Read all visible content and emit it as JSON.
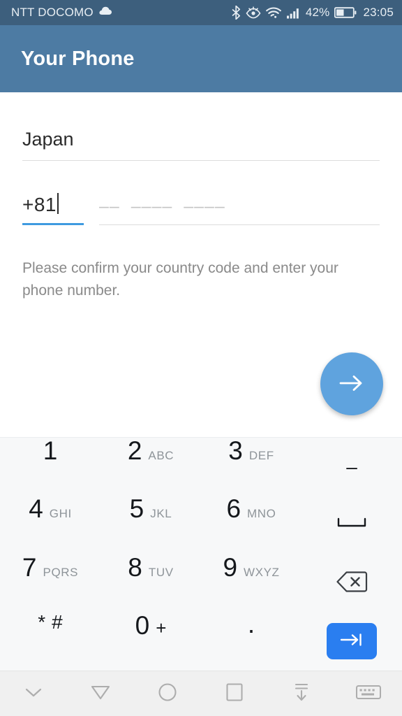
{
  "status_bar": {
    "carrier": "NTT DOCOMO",
    "cloud_icon": "cloud-icon",
    "bluetooth_icon": "bluetooth-icon",
    "eye_comfort_icon": "eye-comfort-icon",
    "wifi_icon": "wifi-icon",
    "signal_icon": "cellular-signal-icon",
    "battery_percent": "42%",
    "battery_icon": "battery-icon",
    "clock": "23:05",
    "background_color": "#3d5f7d",
    "text_color": "#e8eef3"
  },
  "app_bar": {
    "title": "Your Phone",
    "background_color": "#4d7ba3",
    "title_color": "#ffffff"
  },
  "form": {
    "country": {
      "value": "Japan",
      "underline_color": "#dcdcdc"
    },
    "country_code": {
      "value": "+81",
      "underline_color": "#3f9ae0",
      "focused": "true"
    },
    "phone_number": {
      "value": "",
      "placeholder": "––  ––––  ––––",
      "underline_color": "#dcdcdc"
    },
    "hint": "Please confirm your country code and enter your phone number."
  },
  "next_button": {
    "icon": "arrow-right-icon",
    "color": "#5fa3de"
  },
  "keypad": {
    "background_color": "#f7f8f9",
    "rows": [
      [
        {
          "digit": "1",
          "letters": "",
          "name": "key-1"
        },
        {
          "digit": "2",
          "letters": "ABC",
          "name": "key-2"
        },
        {
          "digit": "3",
          "letters": "DEF",
          "name": "key-3"
        },
        {
          "digit": "",
          "letters": "",
          "symbol": "–",
          "name": "key-dash"
        }
      ],
      [
        {
          "digit": "4",
          "letters": "GHI",
          "name": "key-4"
        },
        {
          "digit": "5",
          "letters": "JKL",
          "name": "key-5"
        },
        {
          "digit": "6",
          "letters": "MNO",
          "name": "key-6"
        },
        {
          "digit": "",
          "letters": "",
          "symbol": "space-icon",
          "name": "key-space"
        }
      ],
      [
        {
          "digit": "7",
          "letters": "PQRS",
          "name": "key-7"
        },
        {
          "digit": "8",
          "letters": "TUV",
          "name": "key-8"
        },
        {
          "digit": "9",
          "letters": "WXYZ",
          "name": "key-9"
        },
        {
          "digit": "",
          "letters": "",
          "symbol": "backspace-icon",
          "name": "key-backspace"
        }
      ],
      [
        {
          "digit": "*",
          "letters": "#",
          "name": "key-star-hash"
        },
        {
          "digit": "0",
          "letters": "+",
          "name": "key-0"
        },
        {
          "digit": ".",
          "letters": "",
          "name": "key-period"
        },
        {
          "digit": "",
          "letters": "",
          "symbol": "enter-tab-icon",
          "name": "key-enter"
        }
      ]
    ],
    "labels": {
      "k1": "1",
      "k2": "2",
      "k2l": "ABC",
      "k3": "3",
      "k3l": "DEF",
      "dash": "–",
      "k4": "4",
      "k4l": "GHI",
      "k5": "5",
      "k5l": "JKL",
      "k6": "6",
      "k6l": "MNO",
      "k7": "7",
      "k7l": "PQRS",
      "k8": "8",
      "k8l": "TUV",
      "k9": "9",
      "k9l": "WXYZ",
      "star": "*",
      "hash": "#",
      "k0": "0",
      "plus": "+",
      "period": "."
    },
    "enter_key_color": "#2a7ef0"
  },
  "nav_bar": {
    "background_color": "#f0f0f0",
    "buttons": [
      {
        "name": "hide-keyboard-chevron-icon"
      },
      {
        "name": "back-triangle-icon"
      },
      {
        "name": "home-circle-icon"
      },
      {
        "name": "recents-square-icon"
      },
      {
        "name": "collapse-keyboard-icon"
      },
      {
        "name": "keyboard-switcher-icon"
      }
    ]
  }
}
